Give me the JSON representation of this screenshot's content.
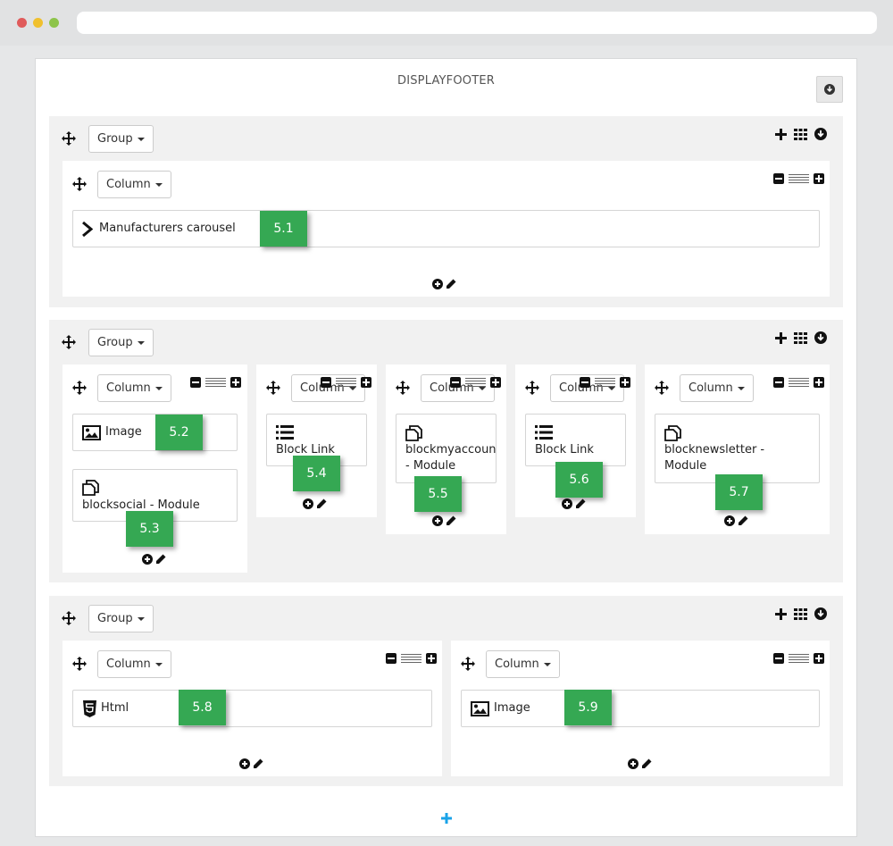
{
  "page": {
    "title": "DISPLAYFOOTER"
  },
  "labels": {
    "group": "Group",
    "column": "Column"
  },
  "modules": {
    "m51": {
      "label": "Manufacturers carousel",
      "icon": "chevron-right-icon"
    },
    "m52": {
      "label": "Image",
      "icon": "image-icon"
    },
    "m53": {
      "label": "blocksocial - Module",
      "icon": "copy-icon"
    },
    "m54": {
      "label": "Block Link",
      "icon": "list-icon"
    },
    "m55": {
      "line1": "blockmyaccountfooter",
      "line2": "- Module",
      "icon": "copy-icon"
    },
    "m56": {
      "label": "Block Link",
      "icon": "list-icon"
    },
    "m57": {
      "line1": "blocknewsletter -",
      "line2": "Module",
      "icon": "copy-icon"
    },
    "m58": {
      "label": "Html",
      "icon": "html5-icon"
    },
    "m59": {
      "label": "Image",
      "icon": "image-icon"
    }
  },
  "badges": {
    "b51": "5.1",
    "b52": "5.2",
    "b53": "5.3",
    "b54": "5.4",
    "b55": "5.5",
    "b56": "5.6",
    "b57": "5.7",
    "b58": "5.8",
    "b59": "5.9"
  },
  "colors": {
    "badge": "#35a853",
    "group_bg": "#f1f1f1",
    "add_group": "#1aa3e8"
  }
}
